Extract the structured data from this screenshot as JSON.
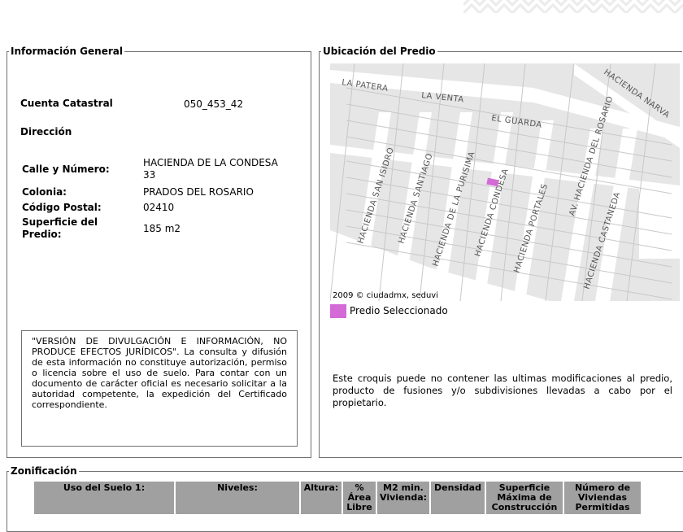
{
  "general": {
    "legend": "Información General",
    "cuenta_label": "Cuenta Catastral",
    "cuenta_value": "050_453_42",
    "direccion_label": "Dirección",
    "calle_label": "Calle y Número:",
    "calle_value_line1": "HACIENDA DE LA CONDESA",
    "calle_value_line2": "33",
    "colonia_label": "Colonia:",
    "colonia_value": "PRADOS DEL ROSARIO",
    "cp_label": "Código Postal:",
    "cp_value": "02410",
    "superficie_label_line1": "Superficie del",
    "superficie_label_line2": "Predio:",
    "superficie_value": "185 m2",
    "disclaimer": "\"VERSIÓN DE DIVULGACIÓN E INFORMACIÓN, NO PRODUCE EFECTOS JURÍDICOS\". La consulta y difusión de esta información no constituye autorización, permiso o licencia sobre el uso de suelo. Para contar con un documento de carácter oficial es necesario solicitar a la autoridad competente, la expedición del Certificado correspondiente."
  },
  "ubicacion": {
    "legend": "Ubicación del Predio",
    "map": {
      "streets": {
        "la_patera": "LA PATERA",
        "la_venta": "LA VENTA",
        "el_guarda": "EL GUARDA",
        "hacienda_narvarte": "HACIENDA NARVA",
        "san_isidro": "HACIENDA SAN ISIDRO",
        "santiago": "HACIENDA SANTIAGO",
        "purisima": "HACIENDA DE LA PURISIMA",
        "condesa": "HACIENDA CONDESA",
        "portales": "HACIENDA PORTALES",
        "del_rosario": "AV. HACIENDA DEL ROSARIO",
        "castaneda": "HACIENDA CASTANEDA"
      },
      "credit": "2009 © ciudadmx, seduvi",
      "highlight_color": "#d46ad6"
    },
    "legend_item": "Predio Seleccionado",
    "note": "Este croquis puede no contener las ultimas modificaciones al predio, producto de fusiones y/o subdivisiones llevadas a cabo por el propietario."
  },
  "zonificacion": {
    "legend": "Zonificación",
    "columns": [
      "Uso del Suelo 1:",
      "Niveles:",
      "Altura:",
      "% Área Libre",
      "M2 min. Vivienda:",
      "Densidad",
      "Superficie Máxima de Construcción",
      "Número de Viviendas Permitidas"
    ]
  }
}
